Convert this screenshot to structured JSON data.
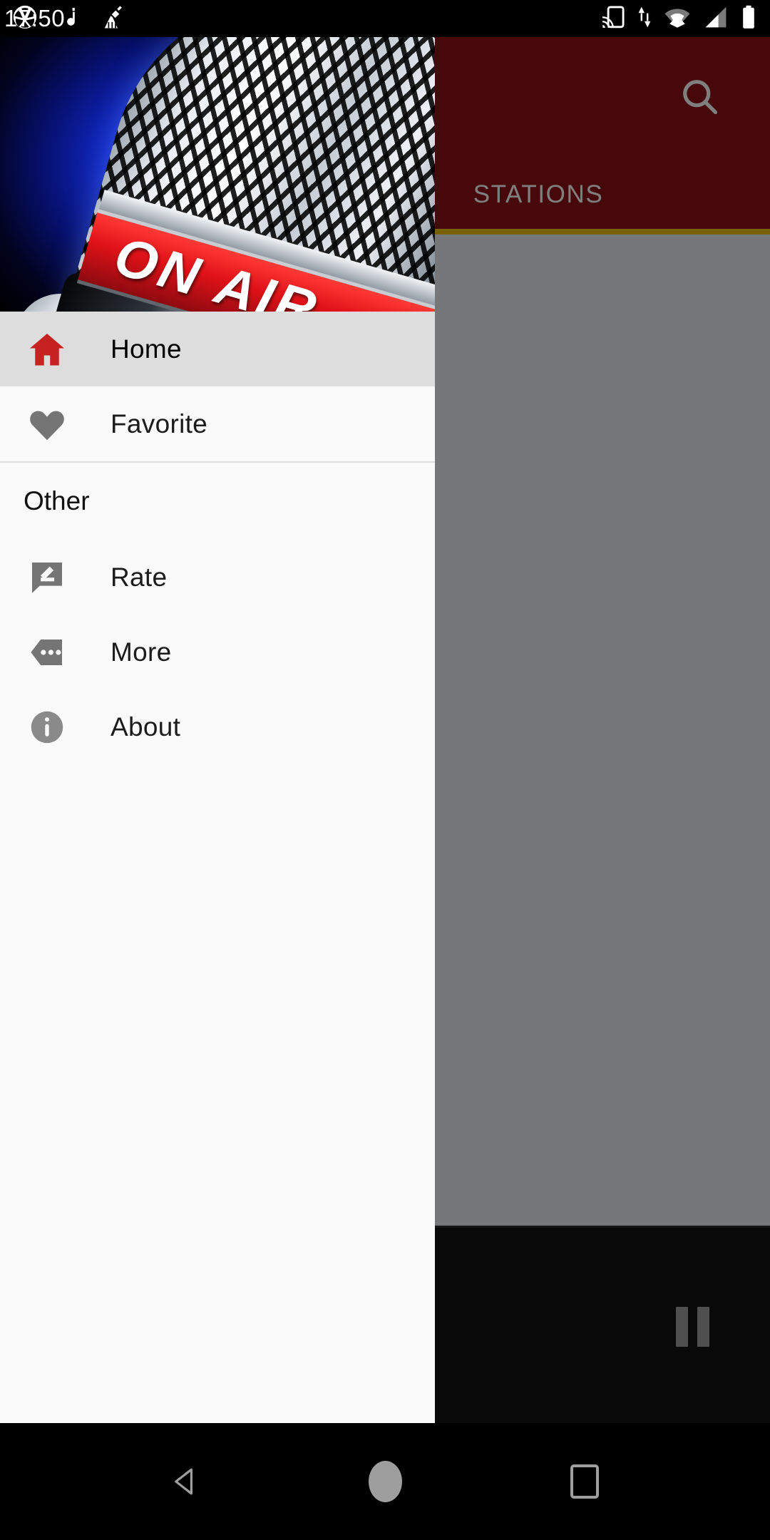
{
  "status_bar": {
    "time": "17:50",
    "left_icons": [
      "camera-aperture-icon",
      "music-note-icon",
      "cleaner-broom-icon"
    ],
    "right_icons": [
      "cast-icon",
      "data-transfer-icon",
      "wifi-icon",
      "signal-icon",
      "battery-icon"
    ]
  },
  "app": {
    "toolbar": {
      "background_color": "#8c1116",
      "search_icon": "search-icon"
    },
    "tabs": [
      {
        "label": "STATIONS",
        "selected": true,
        "indicator_color": "#f4c300"
      }
    ],
    "player": {
      "background_color": "#121212",
      "button_icon": "pause-icon",
      "button_state": "pause"
    }
  },
  "drawer": {
    "header": {
      "image_alt": "ON AIR studio microphone",
      "banner_text": "ON AIR"
    },
    "primary_items": [
      {
        "label": "Home",
        "icon": "home-icon",
        "icon_color": "#c62222",
        "selected": true
      },
      {
        "label": "Favorite",
        "icon": "heart-icon",
        "icon_color": "#757575",
        "selected": false
      }
    ],
    "section_title": "Other",
    "other_items": [
      {
        "label": "Rate",
        "icon": "rate-comment-edit-icon",
        "icon_color": "#757575"
      },
      {
        "label": "More",
        "icon": "more-tag-icon",
        "icon_color": "#757575"
      },
      {
        "label": "About",
        "icon": "info-icon",
        "icon_color": "#8a8a8a"
      }
    ]
  },
  "navigation_bar": {
    "buttons": [
      {
        "name": "back",
        "icon": "back-triangle-icon"
      },
      {
        "name": "home",
        "icon": "home-circle-icon"
      },
      {
        "name": "recents",
        "icon": "recents-square-icon"
      }
    ]
  },
  "colors": {
    "primary": "#8c1116",
    "accent": "#f4c300",
    "drawer_bg": "#fafafa",
    "selected_row": "#dddddd"
  }
}
